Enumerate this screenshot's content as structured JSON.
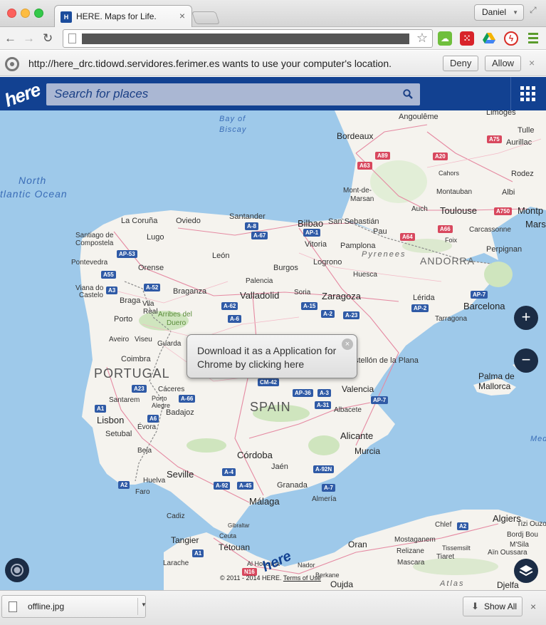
{
  "browser": {
    "tab_title": "HERE. Maps for Life.",
    "tab_favicon_text": "H",
    "profile_name": "Daniel",
    "ext_icons": [
      "green-cloud-icon",
      "grid-apps-icon",
      "google-drive-icon",
      "flash-icon",
      "chrome-menu-icon"
    ]
  },
  "infobar": {
    "message": "http://here_drc.tidowd.servidores.ferimer.es wants to use your computer's location.",
    "deny_label": "Deny",
    "allow_label": "Allow",
    "close_label": "×"
  },
  "header": {
    "logo_text": "here",
    "search_placeholder": "Search for places"
  },
  "map": {
    "tooltip_text": "Download it as a Application for Chrome by clicking here",
    "tooltip_close": "×",
    "zoom_in_label": "+",
    "zoom_out_label": "−",
    "copyright": "© 2011 - 2014 HERE.",
    "terms_label": "Terms of Use",
    "watermark": "here",
    "countries": {
      "spain": "SPAIN",
      "portugal": "PORTUGAL",
      "andorra": "ANDORRA"
    },
    "seas": {
      "north_atlantic_1": "North",
      "north_atlantic_2": "tlantic Ocean",
      "biscay_1": "Bay of",
      "biscay_2": "Biscay",
      "mediterranean": "Med",
      "pyrenees": "Pyrenees",
      "atlas": "Atlas"
    },
    "cities": {
      "bordeaux": "Bordeaux",
      "angouleme": "Angoulême",
      "limoges": "Limoges",
      "tulle": "Tulle",
      "aurillac": "Aurillac",
      "cahors": "Cahors",
      "rodez": "Rodez",
      "montauban": "Montauban",
      "albi": "Albi",
      "toulouse": "Toulouse",
      "montp": "Montp",
      "auch": "Auch",
      "mont_de_marsan_1": "Mont-de-",
      "mont_de_marsan_2": "Marsan",
      "carcassonne": "Carcassonne",
      "pau": "Pau",
      "foix": "Foix",
      "perpignan": "Perpignan",
      "mars": "Mars",
      "san_sebastian": "San Sebastián",
      "bilbao": "Bilbao",
      "vitoria": "Vitoria",
      "pamplona": "Pamplona",
      "logrono": "Logrono",
      "huesca": "Huesca",
      "lerida": "Lérida",
      "barcelona": "Barcelona",
      "tarragona": "Tarragona",
      "zaragoza": "Zaragoza",
      "soria": "Soria",
      "burgos": "Burgos",
      "palencia": "Palencia",
      "valladolid": "Valladolid",
      "leon": "León",
      "santander": "Santander",
      "oviedo": "Oviedo",
      "la_coruna": "La Coruña",
      "lugo": "Lugo",
      "santiago_1": "Santiago de",
      "santiago_2": "Compostela",
      "pontevedra": "Pontevedra",
      "orense": "Orense",
      "viana_1": "Viana do",
      "viana_2": "Castelo",
      "braga": "Braga",
      "vila_1": "Vila",
      "vila_2": "Real",
      "braganza": "Braganza",
      "porto": "Porto",
      "aveiro": "Aveiro",
      "viseu": "Viseu",
      "guarda": "Guarda",
      "coimbra": "Coimbra",
      "caceres": "Cáceres",
      "portalegre_1": "Porto",
      "portalegre_2": "Alegre",
      "santarem": "Santarem",
      "badajoz": "Badajoz",
      "lisbon": "Lisbon",
      "setubal": "Setubal",
      "evora": "Évora",
      "beja": "Beja",
      "faro": "Faro",
      "huelva": "Huelva",
      "seville": "Seville",
      "cordoba": "Córdoba",
      "jaen": "Jaén",
      "granada": "Granada",
      "malaga": "Málaga",
      "almeria": "Almería",
      "murcia": "Murcia",
      "alicante": "Alicante",
      "valencia": "Valencia",
      "albacete": "Albacete",
      "castellon": "stellón de la Plana",
      "palma_1": "Palma de",
      "palma_2": "Mallorca",
      "cadiz": "Cadiz",
      "gibraltar": "Gibraltar",
      "tangier": "Tangier",
      "ceuta": "Ceuta",
      "tetouan": "Tétouan",
      "larache": "Larache",
      "al_hoceima": "Al Hoceima",
      "nador": "Nador",
      "berkane": "Berkane",
      "oujda": "Oujda",
      "oran": "Oran",
      "mostaganem": "Mostaganem",
      "relizane": "Relizane",
      "chlef": "Chlef",
      "tiaret": "Tiaret",
      "tissemsilt": "Tissemsilt",
      "mascara": "Mascara",
      "ain_oussara": "Aïn Oussara",
      "algiers": "Algiers",
      "bordj_bou": "Bordj Bou",
      "msila": "M'Sila",
      "djelfa": "Djelfa",
      "tizi_ouzou": "Tizi Ouzou",
      "arriba_1": "Arribes del",
      "arriba_2": "Duero"
    },
    "roads": {
      "a89": "A89",
      "a63": "A63",
      "a75": "A75",
      "a20": "A20",
      "a750": "A750",
      "a64": "A64",
      "a66": "A66",
      "a8": "A-8",
      "a67": "A-67",
      "ap1": "AP-1",
      "ap53": "AP-53",
      "a55": "A55",
      "a3": "A3",
      "a52": "A-52",
      "a62": "A-62",
      "a6": "A-6",
      "a15": "A-15",
      "a2": "A-2",
      "a23": "A-23",
      "ap7": "AP-7",
      "ap2": "AP-2",
      "a23pt": "A23",
      "a1": "A1",
      "a66b": "A-66",
      "cm42": "CM-42",
      "ap36": "AP-36",
      "a3b": "A-3",
      "a31": "A-31",
      "ap7b": "AP-7",
      "a4": "A-4",
      "a92": "A-92",
      "a45": "A-45",
      "a92n": "A-92N",
      "a7": "A-7",
      "a2pt": "A2",
      "a6pt": "A6",
      "n16": "N16",
      "a1ma": "A1",
      "a2ma": "A2"
    },
    "ocean_color": "#9ec9ea",
    "land_color": "#f5f3ee",
    "brand_color": "#124191"
  },
  "downloads": {
    "file_name": "offline.jpg",
    "show_all_label": "Show All",
    "close_label": "×"
  }
}
